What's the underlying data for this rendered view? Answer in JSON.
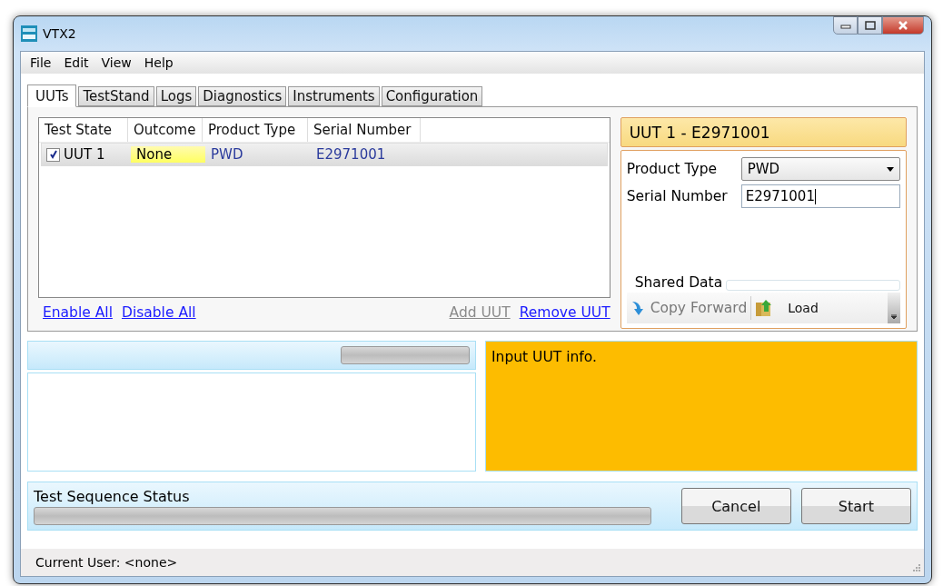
{
  "window": {
    "title": "VTX2"
  },
  "menu": [
    "File",
    "Edit",
    "View",
    "Help"
  ],
  "tabs": [
    {
      "label": "UUTs",
      "selected": true
    },
    {
      "label": "TestStand",
      "selected": false
    },
    {
      "label": "Logs",
      "selected": false
    },
    {
      "label": "Diagnostics",
      "selected": false
    },
    {
      "label": "Instruments",
      "selected": false
    },
    {
      "label": "Configuration",
      "selected": false
    }
  ],
  "uut_table": {
    "columns": [
      "Test State",
      "Outcome",
      "Product Type",
      "Serial Number"
    ],
    "rows": [
      {
        "checked": true,
        "test_state": "UUT 1",
        "outcome": "None",
        "product_type": "PWD",
        "serial_number": "E2971001",
        "selected": true
      }
    ]
  },
  "links": [
    {
      "label": "Enable All",
      "disabled": false
    },
    {
      "label": "Disable All",
      "disabled": false
    },
    {
      "label": "Add UUT",
      "disabled": true
    },
    {
      "label": "Remove UUT",
      "disabled": false
    }
  ],
  "details": {
    "title": "UUT 1 - E2971001",
    "product_type": {
      "label": "Product Type",
      "value": "PWD"
    },
    "serial_number": {
      "label": "Serial Number",
      "value": "E2971001"
    },
    "shared_data": {
      "title": "Shared Data",
      "copy_forward": {
        "label": "Copy Forward",
        "disabled": true
      },
      "load": {
        "label": "Load",
        "disabled": false
      }
    }
  },
  "step_progress": {
    "level": 0
  },
  "message": "Input UUT info.",
  "sequence_status": {
    "label": "Test Sequence Status",
    "level": 0
  },
  "buttons": [
    "Cancel",
    "Start"
  ],
  "status_bar": "Current User: <none>"
}
